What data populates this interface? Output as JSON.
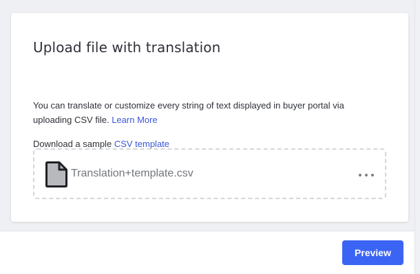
{
  "card": {
    "title": "Upload file with translation",
    "description_text": "You can translate or customize every string of text displayed in buyer portal via uploading CSV file.",
    "learn_more_label": "Learn More",
    "sample_prefix": "Download a sample",
    "csv_template_label": "CSV template"
  },
  "file": {
    "name": "Translation+template.csv",
    "icon": "file-icon"
  },
  "footer": {
    "preview_label": "Preview"
  },
  "colors": {
    "accent": "#3c64f4",
    "link": "#3b57d8",
    "text": "#2e3138",
    "muted": "#73767d",
    "background": "#eff0f3"
  }
}
